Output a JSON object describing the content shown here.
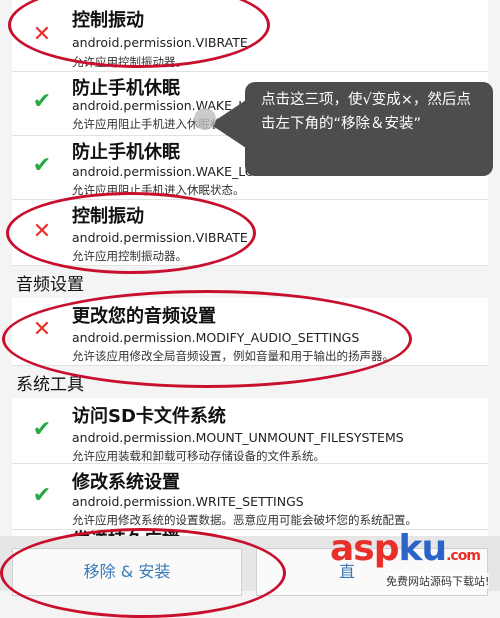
{
  "rows": [
    {
      "status": "x",
      "title": "控制振动",
      "perm": "android.permission.VIBRATE",
      "desc": "允许应用控制振动器。"
    },
    {
      "status": "check",
      "title": "防止手机休眠",
      "perm": "android.permission.WAKE_LOCK",
      "desc": "允许应用阻止手机进入休眠状态。"
    },
    {
      "status": "check",
      "title": "防止手机休眠",
      "perm": "android.permission.WAKE_LOCK",
      "desc": "允许应用阻止手机进入休眠状态。"
    },
    {
      "status": "x",
      "title": "控制振动",
      "perm": "android.permission.VIBRATE",
      "desc": "允许应用控制振动器。"
    },
    {
      "status": "x",
      "title": "更改您的音频设置",
      "perm": "android.permission.MODIFY_AUDIO_SETTINGS",
      "desc": "允许该应用修改全局音频设置，例如音量和用于输出的扬声器。"
    },
    {
      "status": "check",
      "title": "访问SD卡文件系统",
      "perm": "android.permission.MOUNT_UNMOUNT_FILESYSTEMS",
      "desc": "允许应用装载和卸载可移动存储设备的文件系统。"
    },
    {
      "status": "check",
      "title": "修改系统设置",
      "perm": "android.permission.WRITE_SETTINGS",
      "desc": "允许应用修改系统的设置数据。恶意应用可能会破坏您的系统配置。"
    }
  ],
  "sections": {
    "audio": "音频设置",
    "system": "系统工具"
  },
  "tooltip": {
    "text": "点击这三项，使√变成×，然后点击左下角的“移除＆安装”"
  },
  "partial_row_title": "发送持久广播",
  "buttons": {
    "remove_install": "移除 & 安装",
    "right_partial": "直"
  },
  "watermark": {
    "brand_a": "asp",
    "brand_b": "ku",
    "brand_c": ".com",
    "sub": "免费网站源码下载站!"
  },
  "colors": {
    "x_mark": "#e8302b",
    "check_mark": "#28a745",
    "annotation": "#c8102e"
  },
  "icons": {
    "x": "✕",
    "check": "✔"
  }
}
